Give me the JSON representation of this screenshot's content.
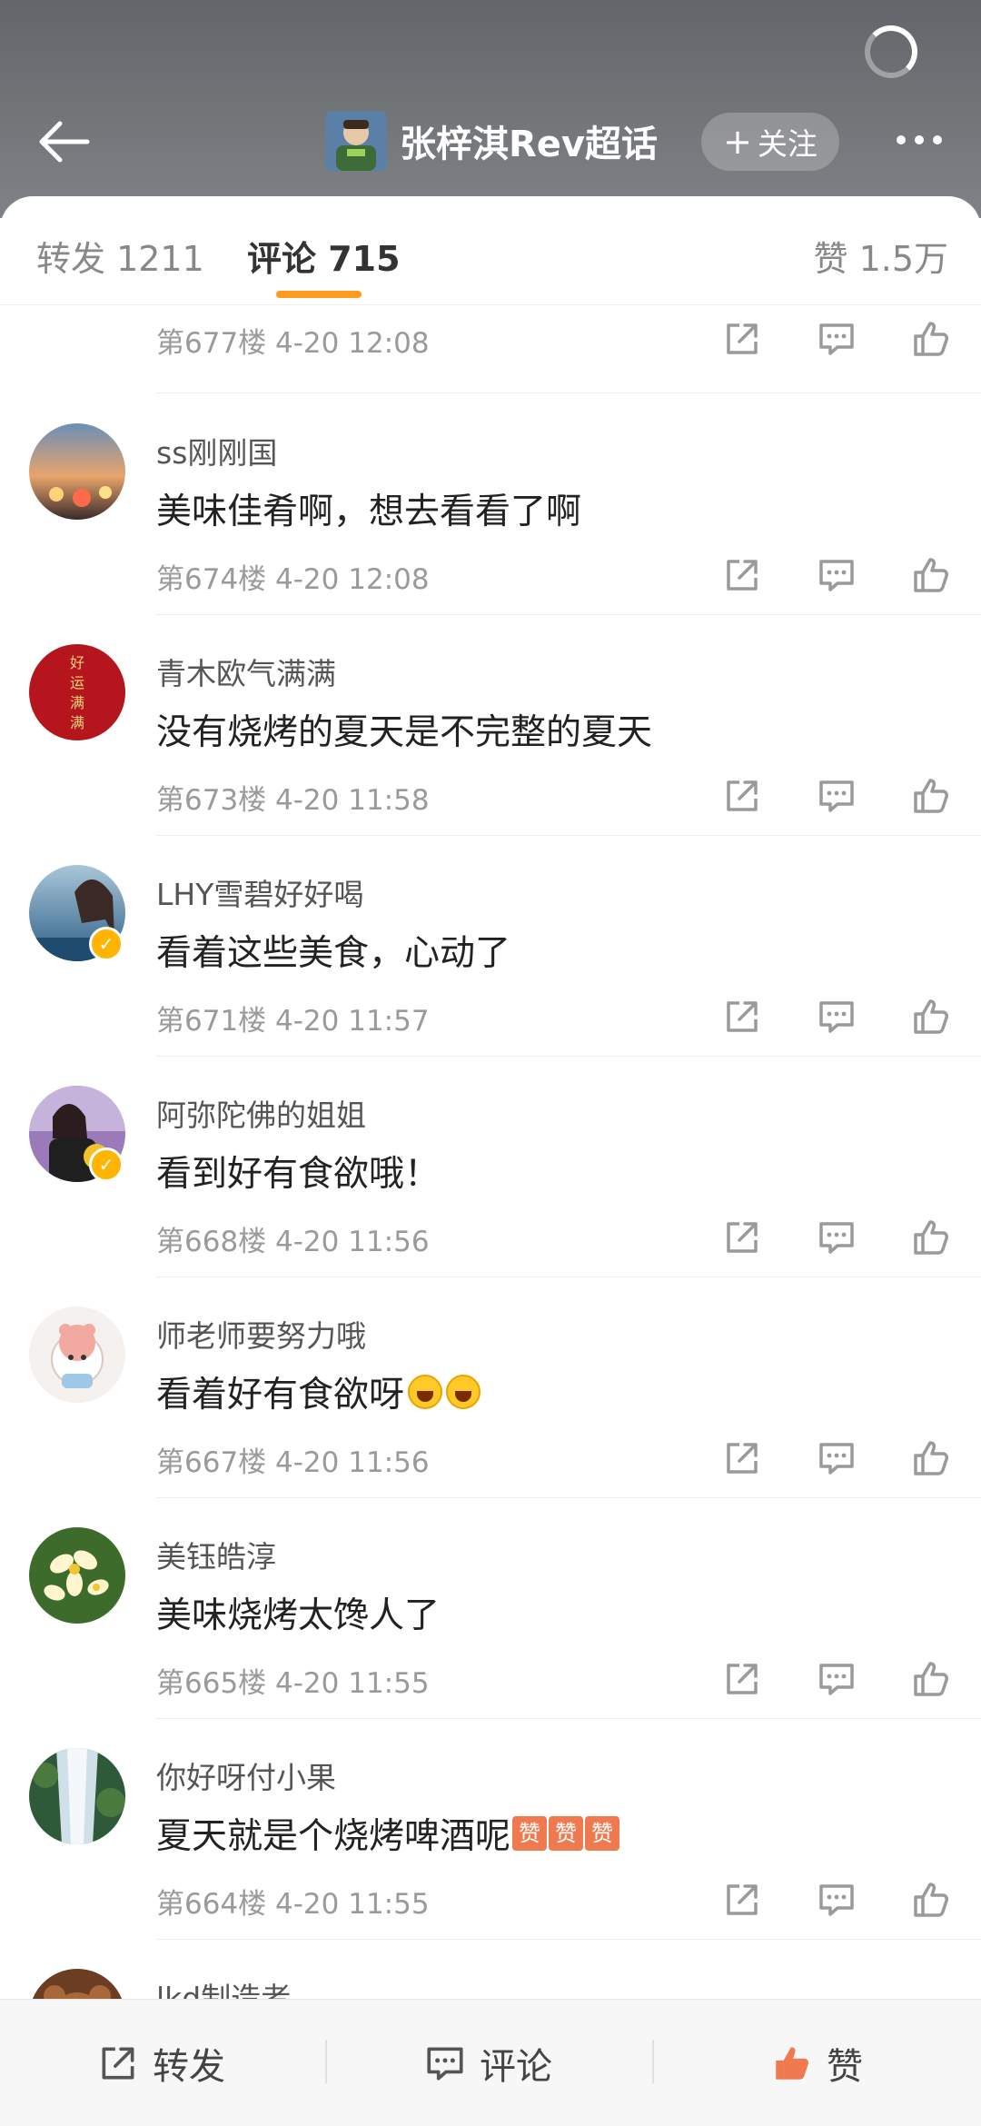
{
  "header": {
    "title": "张梓淇Rev超话",
    "follow_label": "关注"
  },
  "tabs": {
    "repost": "转发 1211",
    "comment": "评论 715",
    "likes": "赞 1.5万"
  },
  "first_row": {
    "meta": "第677楼 4-20 12:08"
  },
  "comments": [
    {
      "name": "ss刚刚国",
      "text": "美味佳肴啊，想去看看了啊",
      "meta": "第674楼 4-20 12:08"
    },
    {
      "name": "青木欧气满满",
      "text": "没有烧烤的夏天是不完整的夏天",
      "meta": "第673楼 4-20 11:58",
      "avatar_text": "好运满满"
    },
    {
      "name": "LHY雪碧好好喝",
      "text": "看着这些美食，心动了",
      "meta": "第671楼 4-20 11:57",
      "verified": true
    },
    {
      "name": "阿弥陀佛的姐姐",
      "text": "看到好有食欲哦！",
      "meta": "第668楼 4-20 11:56",
      "verified": true
    },
    {
      "name": "师老师要努力哦",
      "text": "看着好有食欲呀",
      "meta": "第667楼 4-20 11:56",
      "emoji": "laughing-face"
    },
    {
      "name": "美钰皓淳",
      "text": "美味烧烤太馋人了",
      "meta": "第665楼 4-20 11:55"
    },
    {
      "name": "你好呀付小果",
      "text": "夏天就是个烧烤啤酒呢",
      "meta": "第664楼 4-20 11:55",
      "emoji_text": [
        "赞",
        "赞",
        "赞"
      ]
    },
    {
      "name": "lkd制造者"
    }
  ],
  "bottom_bar": {
    "repost": "转发",
    "comment": "评论",
    "like": "赞"
  },
  "colors": {
    "accent": "#ff9a1f",
    "like_active": "#f07a50",
    "verified": "#ffb400"
  }
}
